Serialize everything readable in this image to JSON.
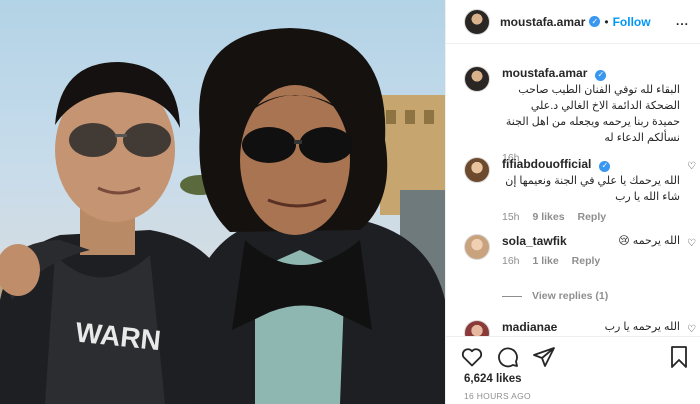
{
  "post": {
    "username": "moustafa.amar",
    "follow_label": "Follow",
    "more_label": "...",
    "caption": {
      "username": "moustafa.amar",
      "text": "البقاء لله توفي الفنان الطيب صاحب الضحكة الدائمة الاخ الغالي د.علي حميدة ربنا يرحمه ويجعله من اهل الجنة نسألكم الدعاء له",
      "time": "16h"
    },
    "comments": [
      {
        "username": "fifiabdouofficial",
        "text": "الله يرحمك يا علي في الجنة ونعيمها إن شاء الله يا رب",
        "time": "15h",
        "likes": "9 likes",
        "reply": "Reply"
      },
      {
        "username": "sola_tawfik",
        "text": "الله يرحمه 😢",
        "time": "16h",
        "likes": "1 like",
        "reply": "Reply"
      },
      {
        "username": "madianae",
        "text": "الله يرحمه يا رب",
        "time": "",
        "likes": "",
        "reply": ""
      }
    ],
    "view_replies": "View replies (1)",
    "likes_count": "6,624 likes",
    "time_ago": "16 HOURS AGO",
    "photo_shirt_text": "WARN"
  }
}
